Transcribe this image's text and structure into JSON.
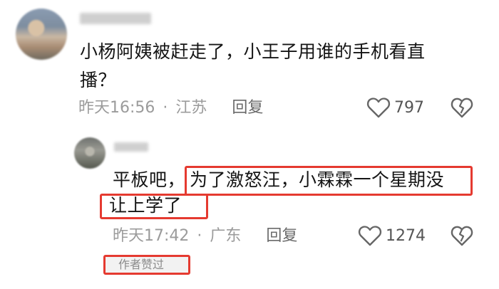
{
  "comment": {
    "text_line1": "小杨阿姨被赶走了，小王子用谁的手机看直",
    "text_line2": "播？",
    "time": "昨天16:56",
    "separator": "·",
    "location": "江苏",
    "reply_label": "回复",
    "likes": "797"
  },
  "reply": {
    "text_part1": "平板吧，",
    "text_part2": "为了激怒汪，小霖霖一个星期没",
    "text_line2": "让上学了",
    "time": "昨天17:42",
    "separator": "·",
    "location": "广东",
    "reply_label": "回复",
    "likes": "1274",
    "author_badge": "作者赞过"
  },
  "colors": {
    "highlight": "#e53a30",
    "meta_text": "#9b9b9b"
  },
  "icons": [
    "heart-outline-icon",
    "broken-heart-icon"
  ]
}
